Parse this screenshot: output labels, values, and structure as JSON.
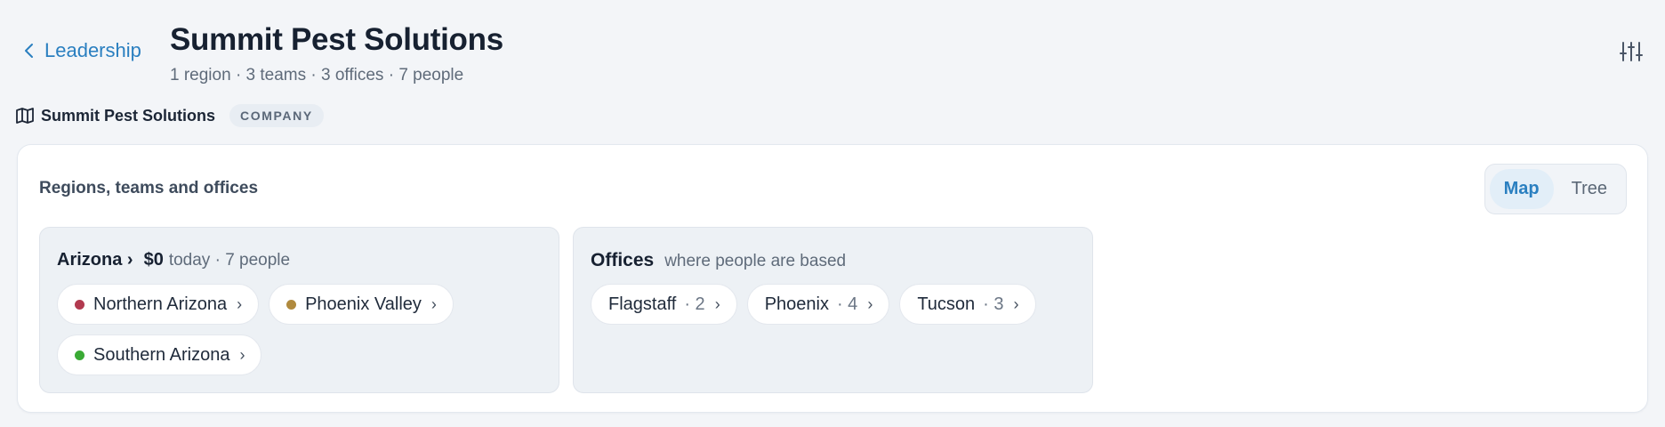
{
  "header": {
    "back_label": "Leadership",
    "title": "Summit Pest Solutions",
    "subtitle": "1 region · 3 teams · 3 offices · 7 people",
    "settings_icon": "sliders-icon"
  },
  "breadcrumb": {
    "icon": "map-icon",
    "name": "Summit Pest Solutions",
    "badge": "COMPANY"
  },
  "card": {
    "title": "Regions, teams and offices",
    "view_toggle": {
      "map": "Map",
      "tree": "Tree",
      "active": "Map"
    }
  },
  "region": {
    "name": "Arizona",
    "chevron": "›",
    "amount": "$0",
    "meta": "today · 7 people",
    "teams": [
      {
        "name": "Northern Arizona",
        "color": "#b23a4f"
      },
      {
        "name": "Phoenix Valley",
        "color": "#b08a3e"
      },
      {
        "name": "Southern Arizona",
        "color": "#3aaa35"
      }
    ]
  },
  "offices": {
    "title": "Offices",
    "subtitle": "where people are based",
    "items": [
      {
        "name": "Flagstaff",
        "count": "· 2"
      },
      {
        "name": "Phoenix",
        "count": "· 4"
      },
      {
        "name": "Tucson",
        "count": "· 3"
      }
    ]
  },
  "chevron": "›"
}
